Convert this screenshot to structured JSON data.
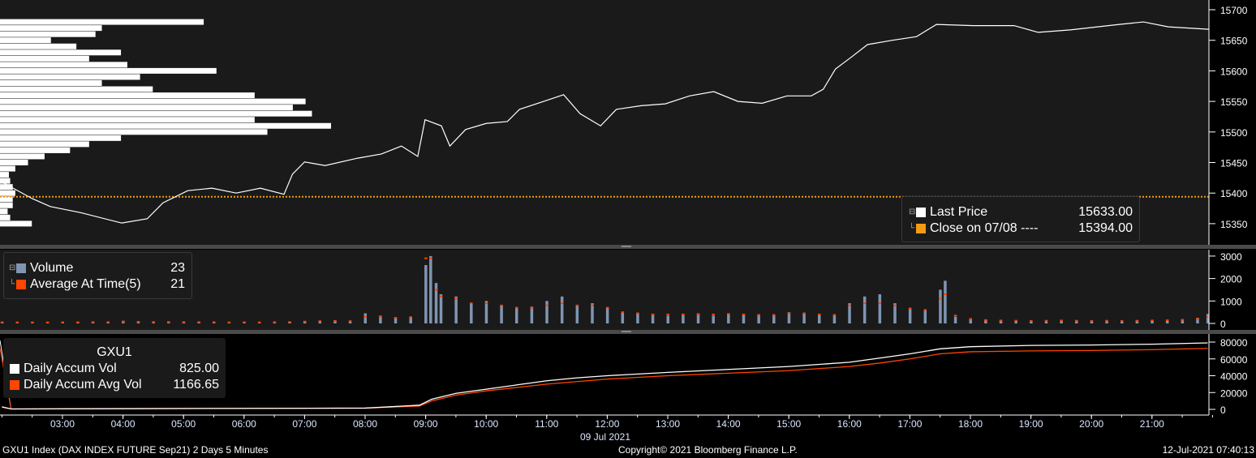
{
  "chart_data": [
    {
      "type": "line",
      "panel": "price",
      "title": "GXU1 Index Last Price",
      "ylim": [
        15320,
        15710
      ],
      "yticks": [
        15350,
        15400,
        15450,
        15500,
        15550,
        15600,
        15650,
        15700
      ],
      "x_unit": "hour of day",
      "series": [
        {
          "name": "Last Price",
          "color": "#ffffff",
          "x": [
            2.0,
            2.5,
            2.8,
            3.3,
            3.98,
            4.4,
            4.66,
            5.07,
            5.47,
            5.87,
            6.27,
            6.66,
            6.8,
            7.0,
            7.34,
            7.87,
            8.27,
            8.6,
            8.87,
            8.99,
            9.26,
            9.4,
            9.66,
            10.0,
            10.35,
            10.55,
            10.95,
            11.28,
            11.55,
            11.89,
            12.15,
            12.56,
            12.96,
            13.36,
            13.76,
            14.16,
            14.56,
            14.97,
            15.37,
            15.57,
            15.77,
            16.04,
            16.3,
            16.71,
            17.11,
            17.44,
            18.05,
            18.72,
            19.12,
            19.65,
            20.46,
            20.86,
            21.27,
            21.94
          ],
          "y": [
            15418,
            15391,
            15378,
            15368,
            15351,
            15358,
            15384,
            15404,
            15408,
            15400,
            15408,
            15398,
            15431,
            15451,
            15445,
            15457,
            15464,
            15477,
            15460,
            15520,
            15510,
            15477,
            15504,
            15514,
            15517,
            15537,
            15550,
            15561,
            15530,
            15510,
            15537,
            15543,
            15546,
            15559,
            15566,
            15550,
            15547,
            15559,
            15559,
            15570,
            15603,
            15623,
            15643,
            15650,
            15656,
            15676,
            15674,
            15674,
            15663,
            15667,
            15676,
            15680,
            15672,
            15668
          ]
        },
        {
          "name": "Close on 07/08",
          "color": "#f39c12",
          "value": 15394
        }
      ],
      "volume_profile": {
        "price_levels": [
          15350,
          15360,
          15370,
          15380,
          15390,
          15400,
          15410,
          15420,
          15430,
          15440,
          15450,
          15460,
          15470,
          15480,
          15490,
          15500,
          15510,
          15520,
          15530,
          15540,
          15550,
          15560,
          15570,
          15580,
          15590,
          15600,
          15610,
          15620,
          15630,
          15640,
          15650,
          15660,
          15670,
          15680
        ],
        "volume": [
          25,
          8,
          6,
          10,
          10,
          12,
          10,
          8,
          7,
          12,
          22,
          35,
          55,
          70,
          95,
          210,
          260,
          200,
          245,
          230,
          240,
          200,
          120,
          80,
          110,
          170,
          100,
          70,
          95,
          60,
          40,
          75,
          80,
          160
        ]
      }
    },
    {
      "type": "bar",
      "panel": "volume",
      "ylim": [
        0,
        3200
      ],
      "yticks": [
        0,
        1000,
        2000,
        3000
      ],
      "x": [
        2.0,
        2.25,
        2.5,
        2.75,
        3.0,
        3.25,
        3.5,
        3.75,
        4.0,
        4.25,
        4.5,
        4.75,
        5.0,
        5.25,
        5.5,
        5.75,
        6.0,
        6.25,
        6.5,
        6.75,
        7.0,
        7.25,
        7.5,
        7.75,
        8.0,
        8.25,
        8.5,
        8.75,
        9.0,
        9.08,
        9.17,
        9.25,
        9.5,
        9.75,
        10.0,
        10.25,
        10.5,
        10.75,
        11.0,
        11.25,
        11.5,
        11.75,
        12.0,
        12.25,
        12.5,
        12.75,
        13.0,
        13.25,
        13.5,
        13.75,
        14.0,
        14.25,
        14.5,
        14.75,
        15.0,
        15.25,
        15.5,
        15.75,
        16.0,
        16.25,
        16.5,
        16.75,
        17.0,
        17.25,
        17.5,
        17.58,
        17.75,
        18.0,
        18.25,
        18.5,
        18.75,
        19.0,
        19.25,
        19.5,
        19.75,
        20.0,
        20.25,
        20.5,
        20.75,
        21.0,
        21.25,
        21.5,
        21.75,
        21.92
      ],
      "series": [
        {
          "name": "Volume",
          "color": "#7f95b3",
          "values": [
            60,
            40,
            50,
            40,
            60,
            50,
            70,
            60,
            120,
            80,
            60,
            60,
            50,
            50,
            60,
            40,
            50,
            40,
            60,
            70,
            100,
            120,
            130,
            90,
            450,
            350,
            250,
            300,
            2600,
            3000,
            1800,
            1300,
            1200,
            900,
            1000,
            800,
            700,
            750,
            1000,
            1200,
            800,
            900,
            700,
            500,
            450,
            400,
            350,
            400,
            450,
            350,
            450,
            400,
            350,
            350,
            500,
            450,
            400,
            350,
            900,
            1200,
            1300,
            900,
            700,
            600,
            1500,
            1900,
            300,
            180,
            150,
            130,
            120,
            110,
            120,
            140,
            120,
            110,
            120,
            110,
            130,
            140,
            150,
            180,
            250,
            420
          ]
        },
        {
          "name": "Average At Time(5)",
          "color": "#ff4500",
          "values": [
            50,
            45,
            45,
            45,
            50,
            50,
            55,
            55,
            70,
            70,
            60,
            60,
            55,
            55,
            55,
            45,
            50,
            45,
            55,
            60,
            80,
            100,
            110,
            100,
            300,
            300,
            250,
            280,
            2900,
            2900,
            1500,
            1200,
            1100,
            900,
            900,
            800,
            700,
            700,
            800,
            900,
            800,
            800,
            700,
            500,
            450,
            400,
            400,
            400,
            400,
            400,
            420,
            400,
            380,
            380,
            450,
            450,
            400,
            380,
            800,
            900,
            900,
            800,
            650,
            600,
            1100,
            1300,
            350,
            200,
            150,
            130,
            120,
            110,
            120,
            130,
            120,
            110,
            120,
            110,
            120,
            130,
            140,
            160,
            200,
            300
          ]
        }
      ]
    },
    {
      "type": "line",
      "panel": "accumulated",
      "ylim": [
        -5000,
        85000
      ],
      "yticks": [
        0,
        20000,
        40000,
        60000,
        80000
      ],
      "series": [
        {
          "name": "Daily Accum Vol",
          "color": "#ffffff",
          "x": [
            2.0,
            2.15,
            8.0,
            8.9,
            9.1,
            9.5,
            10.0,
            10.5,
            11.0,
            11.5,
            12.0,
            13.0,
            14.0,
            15.0,
            16.0,
            16.5,
            17.0,
            17.5,
            18.0,
            19.0,
            20.0,
            21.0,
            21.92
          ],
          "y": [
            3000,
            500,
            1500,
            5000,
            12000,
            19000,
            24000,
            29000,
            34000,
            37500,
            40000,
            44000,
            47500,
            51000,
            56000,
            61000,
            66000,
            72000,
            74500,
            76000,
            76500,
            77500,
            79000
          ]
        },
        {
          "name": "Daily Accum Avg Vol",
          "color": "#ff4500",
          "x": [
            2.0,
            2.15,
            8.0,
            8.9,
            9.1,
            9.5,
            10.0,
            10.5,
            11.0,
            11.5,
            12.0,
            13.0,
            14.0,
            15.0,
            16.0,
            16.5,
            17.0,
            17.5,
            18.0,
            19.0,
            20.0,
            21.0,
            21.92
          ],
          "y": [
            2500,
            500,
            1500,
            4000,
            10000,
            17000,
            22000,
            26000,
            30000,
            33000,
            36000,
            40000,
            43000,
            46000,
            51000,
            55000,
            60000,
            66000,
            68500,
            69500,
            70000,
            71000,
            72500
          ]
        }
      ]
    }
  ],
  "xaxis": {
    "ticks": [
      "03:00",
      "04:00",
      "05:00",
      "06:00",
      "07:00",
      "08:00",
      "09:00",
      "10:00",
      "11:00",
      "12:00",
      "13:00",
      "14:00",
      "15:00",
      "16:00",
      "17:00",
      "18:00",
      "19:00",
      "20:00",
      "21:00"
    ],
    "date_label": "09 Jul 2021"
  },
  "legend_price": {
    "last_price_label": "Last Price",
    "last_price_value": "15633.00",
    "close_label": "Close on 07/08 ----",
    "close_value": "15394.00"
  },
  "legend_volume": {
    "volume_label": "Volume",
    "volume_value": "23",
    "avg_label": "Average At Time(5)",
    "avg_value": "21"
  },
  "legend_accum": {
    "title": "GXU1",
    "accum_label": "Daily Accum Vol",
    "accum_value": "825.00",
    "avg_label": "Daily Accum Avg Vol",
    "avg_value": "1166.65"
  },
  "footer": {
    "security": "GXU1 Index (DAX INDEX FUTURE  Sep21) 2 Days 5 Minutes",
    "copyright": "Copyright© 2021 Bloomberg Finance L.P.",
    "timestamp": "12-Jul-2021 07:40:13"
  }
}
